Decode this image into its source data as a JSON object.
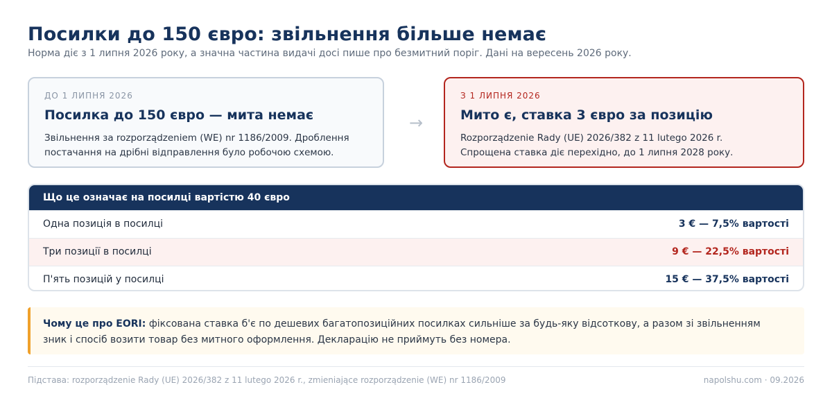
{
  "header": {
    "title": "Посилки до 150 євро: звільнення більше немає",
    "subtitle": "Норма діє з 1 липня 2026 року, а значна частина видачі досі пише про безмитний поріг. Дані на вересень 2026 року."
  },
  "cards": {
    "before": {
      "eyebrow": "ДО 1 ЛИПНЯ 2026",
      "title": "Посилка до 150 євро — мита немає",
      "body_line1": "Звільнення за rozporządzeniem (WE) nr 1186/2009. Дроблення",
      "body_line2": "постачання на дрібні відправлення було робочою схемою."
    },
    "arrow": "→",
    "after": {
      "eyebrow": "З 1 ЛИПНЯ 2026",
      "title": "Мито є, ставка 3 євро за позицію",
      "body_line1": "Rozporządzenie Rady (UE) 2026/382 z 11 lutego 2026 r.",
      "body_line2": "Спрощена ставка діє перехідно, до 1 липня 2028 року."
    }
  },
  "table": {
    "header": "Що це означає на посилці вартістю 40 євро",
    "rows": [
      {
        "label": "Одна позиція в посилці",
        "value": "3 € — 7,5% вартості"
      },
      {
        "label": "Три позиції в посилці",
        "value": "9 € — 22,5% вартості"
      },
      {
        "label": "П'ять позицій у посилці",
        "value": "15 € — 37,5% вартості"
      }
    ]
  },
  "note": {
    "lead": "Чому це про EORI:",
    "text": " фіксована ставка б'є по дешевих багатопозиційних посилках сильніше за будь-яку відсоткову, а разом зі звільненням",
    "text2": "зник і спосіб возити товар без митного оформлення. Декларацію не приймуть без номера."
  },
  "footer": {
    "source": "Підстава: rozporządzenie Rady (UE) 2026/382 z 11 lutego 2026 r., zmieniające rozporządzenie (WE) nr 1186/2009",
    "site": "napolshu.com · 09.2026"
  },
  "colors": {
    "accent": "#17335c",
    "danger": "#b3261e",
    "warning": "#f0a12b"
  }
}
